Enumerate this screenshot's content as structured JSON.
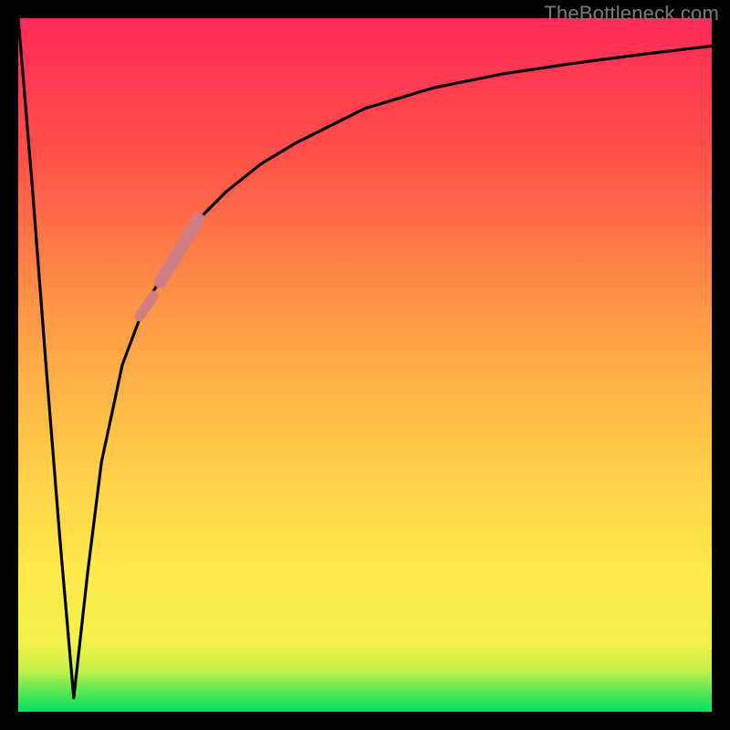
{
  "watermark": "TheBottleneck.com",
  "colors": {
    "frame": "#000000",
    "gradient_top": "#ff2b5a",
    "gradient_mid": "#ffe94b",
    "gradient_bottom": "#00e060",
    "curve": "#000000",
    "highlight": "#cf7f83"
  },
  "chart_data": {
    "type": "line",
    "title": "",
    "xlabel": "",
    "ylabel": "",
    "xlim": [
      0,
      100
    ],
    "ylim": [
      0,
      100
    ],
    "grid": false,
    "series": [
      {
        "name": "bottleneck-curve",
        "x": [
          0,
          2,
          4,
          6,
          8,
          10,
          12,
          15,
          18,
          22,
          26,
          30,
          35,
          40,
          50,
          60,
          70,
          80,
          90,
          100
        ],
        "values": [
          100,
          76,
          50,
          25,
          2,
          20,
          36,
          50,
          58,
          65,
          71,
          75,
          79,
          82,
          87,
          90,
          92,
          93.5,
          94.8,
          96
        ]
      },
      {
        "name": "highlight-lower",
        "x": [
          17.5,
          19.5
        ],
        "values": [
          57,
          60
        ]
      },
      {
        "name": "highlight-upper",
        "x": [
          20.5,
          26
        ],
        "values": [
          62,
          71
        ]
      }
    ],
    "annotations": []
  }
}
